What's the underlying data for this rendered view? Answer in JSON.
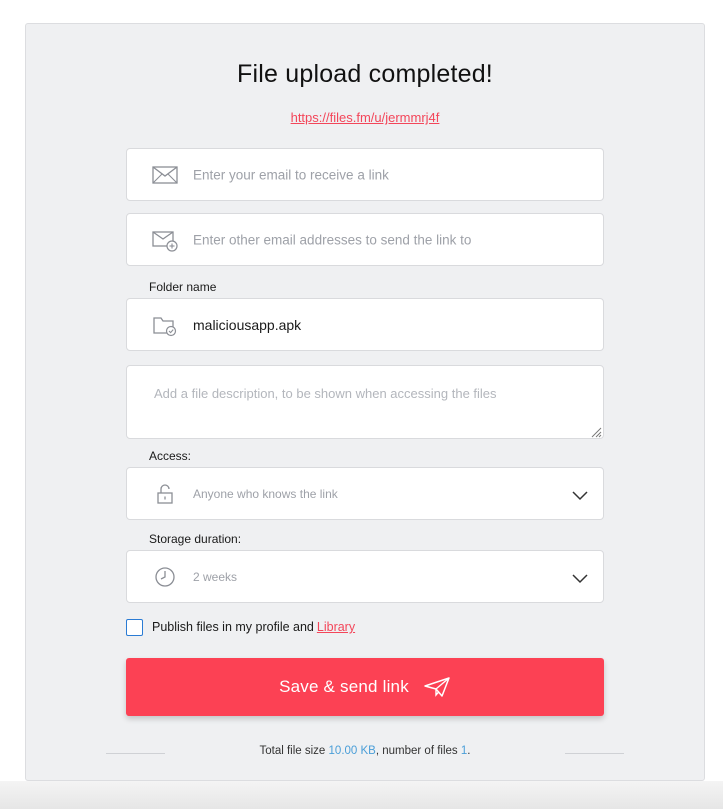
{
  "header": {
    "title": "File upload completed!",
    "link": "https://files.fm/u/jermmrj4f"
  },
  "fields": {
    "email_placeholder": "Enter your email to receive a link",
    "other_emails_placeholder": "Enter other email addresses to send the link to",
    "folder_label": "Folder name",
    "folder_value": "maliciousapp.apk",
    "description_placeholder": "Add a file description, to be shown when accessing the files",
    "access_label": "Access:",
    "access_value": "Anyone who knows the link",
    "storage_label": "Storage duration:",
    "storage_value": "2 weeks"
  },
  "publish": {
    "label": "Publish files in my profile and",
    "link": "Library",
    "checked": false
  },
  "actions": {
    "save_label": "Save & send link"
  },
  "footer": {
    "prefix": "Total file size ",
    "size": "10.00 KB",
    "middle": ", number of files ",
    "count": "1",
    "suffix": "."
  },
  "colors": {
    "accent": "#fc4154",
    "link": "#f3465a",
    "highlight": "#4a9ed8",
    "checkbox": "#2a7bd4"
  },
  "icons": {
    "email": "envelope-icon",
    "other_emails": "envelope-plus-icon",
    "folder": "folder-check-icon",
    "access": "unlock-icon",
    "storage": "clock-icon",
    "dropdown": "chevron-down-icon",
    "send": "paper-plane-icon"
  }
}
